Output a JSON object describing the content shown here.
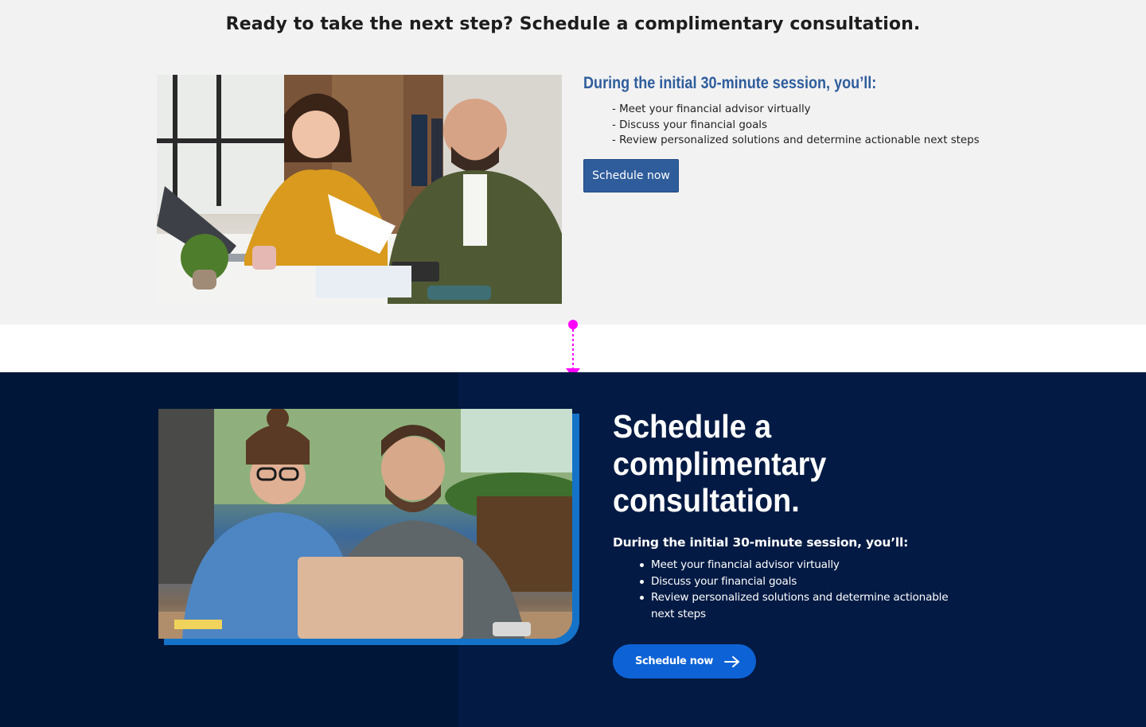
{
  "top": {
    "heading": "Ready to take the next step? Schedule a complimentary consultation.",
    "photo_icon": "photo-two-people-with-laptop-and-papers",
    "subheading": "During the initial 30-minute session, you’ll:",
    "items": [
      "- Meet your financial advisor virtually",
      "- Discuss your financial goals",
      "- Review personalized solutions and determine actionable next steps"
    ],
    "button_label": "Schedule now",
    "accent_color": "#2f5d9c"
  },
  "bottom": {
    "photo_icon": "photo-two-people-looking-at-laptop",
    "title": "Schedule a complimentary consultation.",
    "subheading": "During the initial 30-minute session, you’ll:",
    "items": [
      "Meet your financial advisor virtually",
      "Discuss your financial goals",
      "Review personalized solutions and determine actionable next steps"
    ],
    "button_label": "Schedule now",
    "button_icon": "arrow-right-icon",
    "background_color": "#021a44",
    "button_color": "#0d63d6"
  },
  "marker": {
    "icon": "spacing-arrow-icon",
    "color": "#ff00ff"
  }
}
